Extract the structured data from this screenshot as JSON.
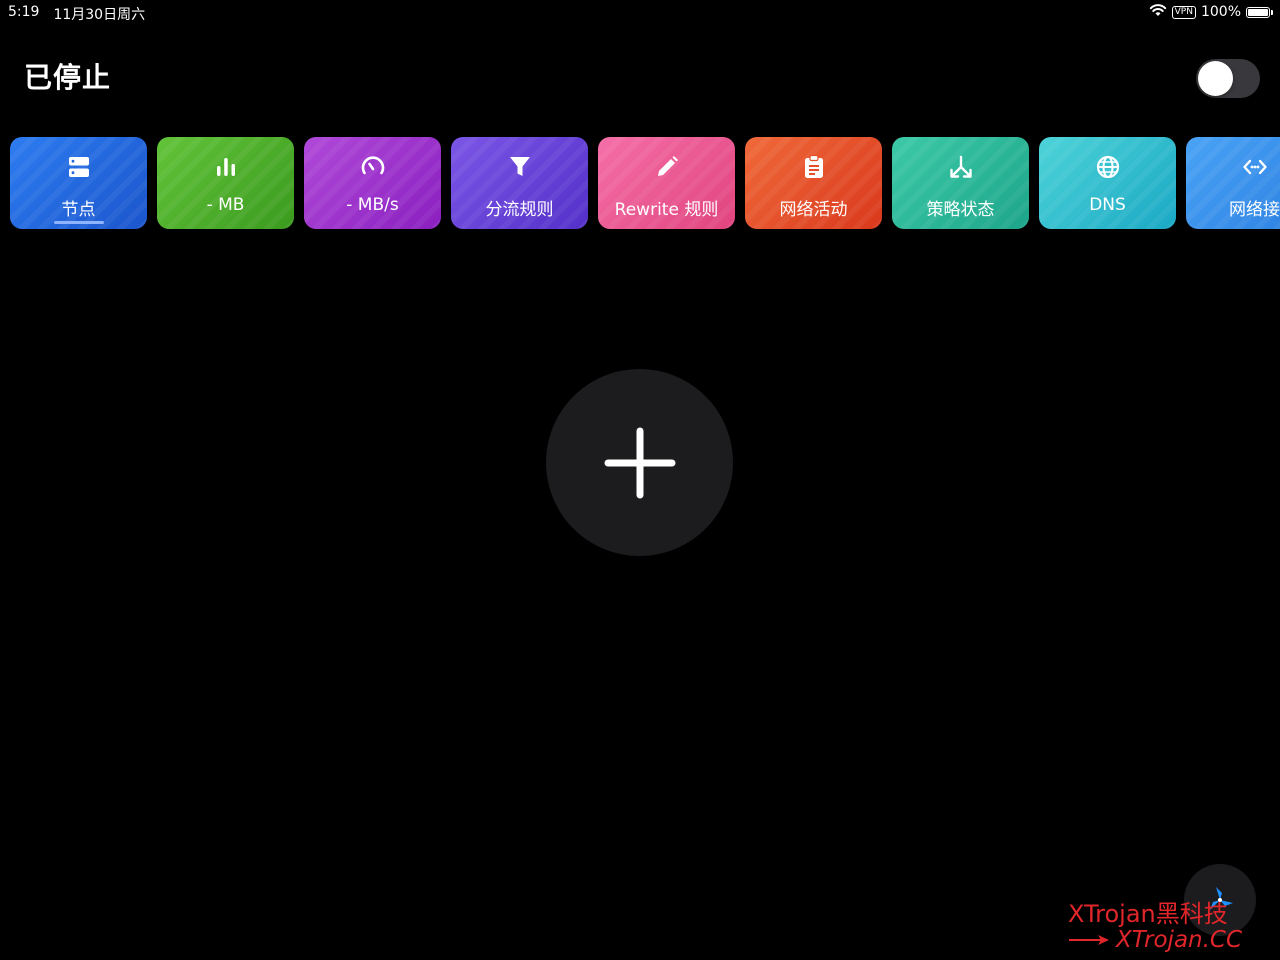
{
  "status_bar": {
    "time": "5:19",
    "date": "11月30日周六",
    "vpn": "VPN",
    "battery": "100%",
    "battery_level": 1.0
  },
  "header": {
    "title": "已停止",
    "toggle_on": false
  },
  "tiles": [
    {
      "label": "节点",
      "icon": "server-icon",
      "gradient": [
        "#2d7cf0",
        "#1b55cc"
      ],
      "selected": true
    },
    {
      "label": "- MB",
      "icon": "bar-chart-icon",
      "gradient": [
        "#63c43a",
        "#3a9a1e"
      ]
    },
    {
      "label": "- MB/s",
      "icon": "speedometer-icon",
      "gradient": [
        "#b049d9",
        "#8a1fbf"
      ]
    },
    {
      "label": "分流规则",
      "icon": "filter-icon",
      "gradient": [
        "#7b56e6",
        "#5430c9"
      ]
    },
    {
      "label": "Rewrite 规则",
      "icon": "pencil-icon",
      "gradient": [
        "#f56fa8",
        "#e0447e"
      ]
    },
    {
      "label": "网络活动",
      "icon": "clipboard-icon",
      "gradient": [
        "#f06a3a",
        "#d9381c"
      ]
    },
    {
      "label": "策略状态",
      "icon": "split-arrow-icon",
      "gradient": [
        "#3ccaa8",
        "#1ea58a"
      ]
    },
    {
      "label": "DNS",
      "icon": "globe-icon",
      "gradient": [
        "#4dd3d8",
        "#1aa8c4"
      ]
    },
    {
      "label": "网络接",
      "icon": "code-icon",
      "gradient": [
        "#4aa3f5",
        "#2a7ee0"
      ]
    }
  ],
  "main": {
    "add_icon": "plus-icon"
  },
  "fab": {
    "icon": "pinwheel-icon"
  },
  "watermark": {
    "line1": "XTrojan黑科技",
    "line2": "XTrojan.CC",
    "color": "#e0262b"
  }
}
